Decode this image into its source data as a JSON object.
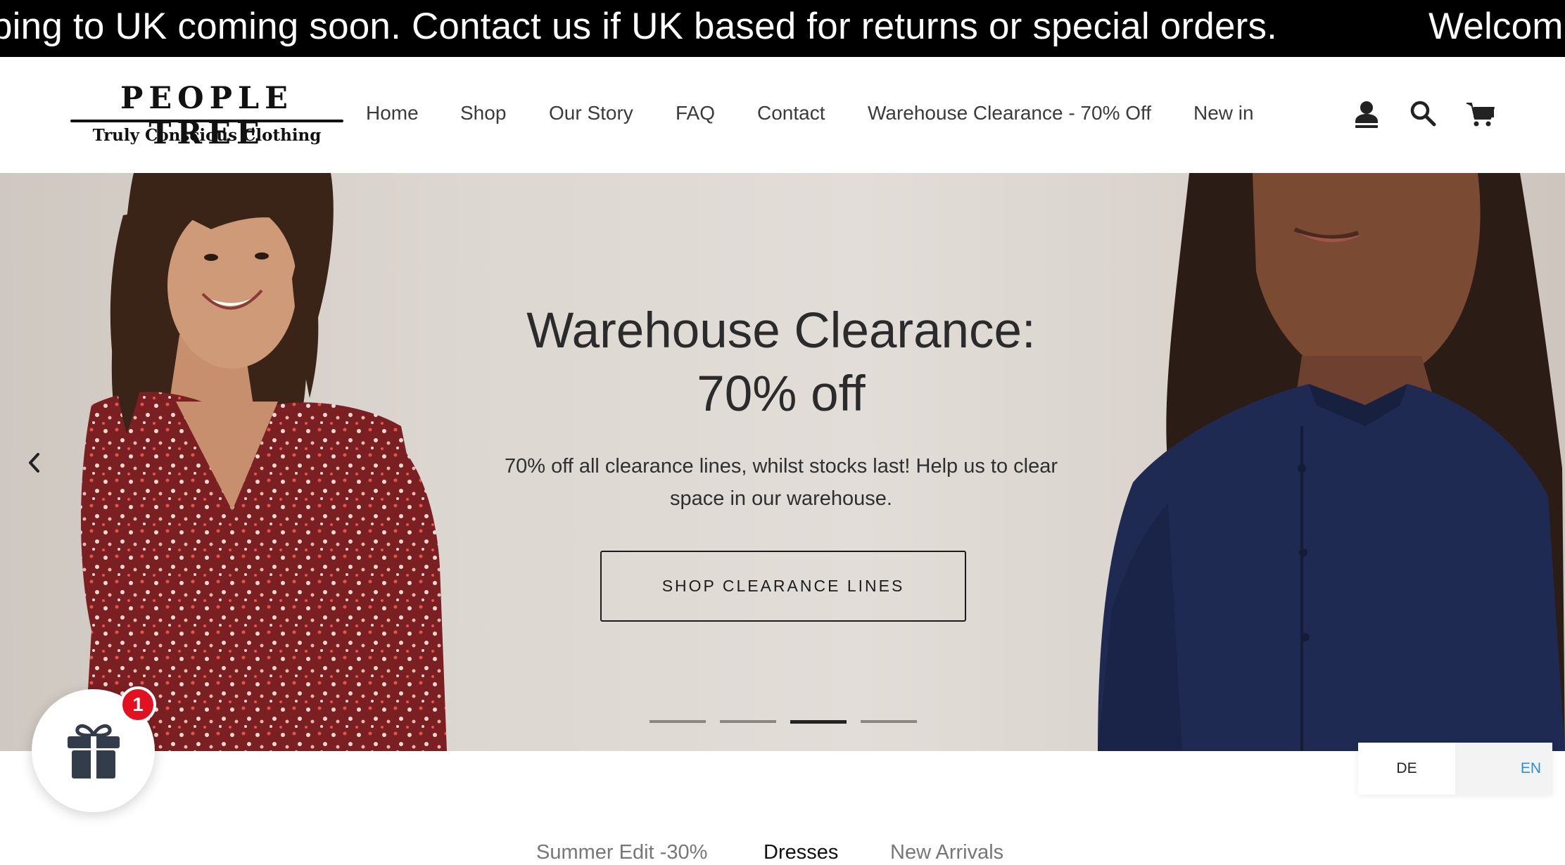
{
  "announcement": {
    "message_left": "ping to UK coming soon. Contact us if UK based for returns or special orders.",
    "message_right": "Welcom"
  },
  "header": {
    "logo": {
      "brand": "PEOPLE TREE",
      "tagline": "Truly Conscious Clothing"
    },
    "nav": [
      "Home",
      "Shop",
      "Our Story",
      "FAQ",
      "Contact",
      "Warehouse Clearance - 70% Off",
      "New in"
    ],
    "icons": [
      "account-icon",
      "search-icon",
      "cart-icon"
    ]
  },
  "hero": {
    "title_line1": "Warehouse Clearance:",
    "title_line2": "70% off",
    "subtitle_line1": "70% off all clearance lines, whilst stocks last! Help us to clear",
    "subtitle_line2": "space in our warehouse.",
    "button_label": "SHOP CLEARANCE LINES",
    "slide_count": 4,
    "active_slide": 3
  },
  "gift_widget": {
    "badge_count": "1",
    "icon": "gift-icon"
  },
  "language": {
    "options": [
      "DE",
      "EN"
    ],
    "selected": "EN"
  },
  "category_tabs": [
    "Summer Edit -30%",
    "Dresses",
    "New Arrivals"
  ],
  "colors": {
    "announcement_bg": "#000000",
    "badge_red": "#e3111f",
    "lang_selected": "#2a8fd6",
    "left_dress": "#7a1f22",
    "right_shirt": "#1f2a52"
  }
}
